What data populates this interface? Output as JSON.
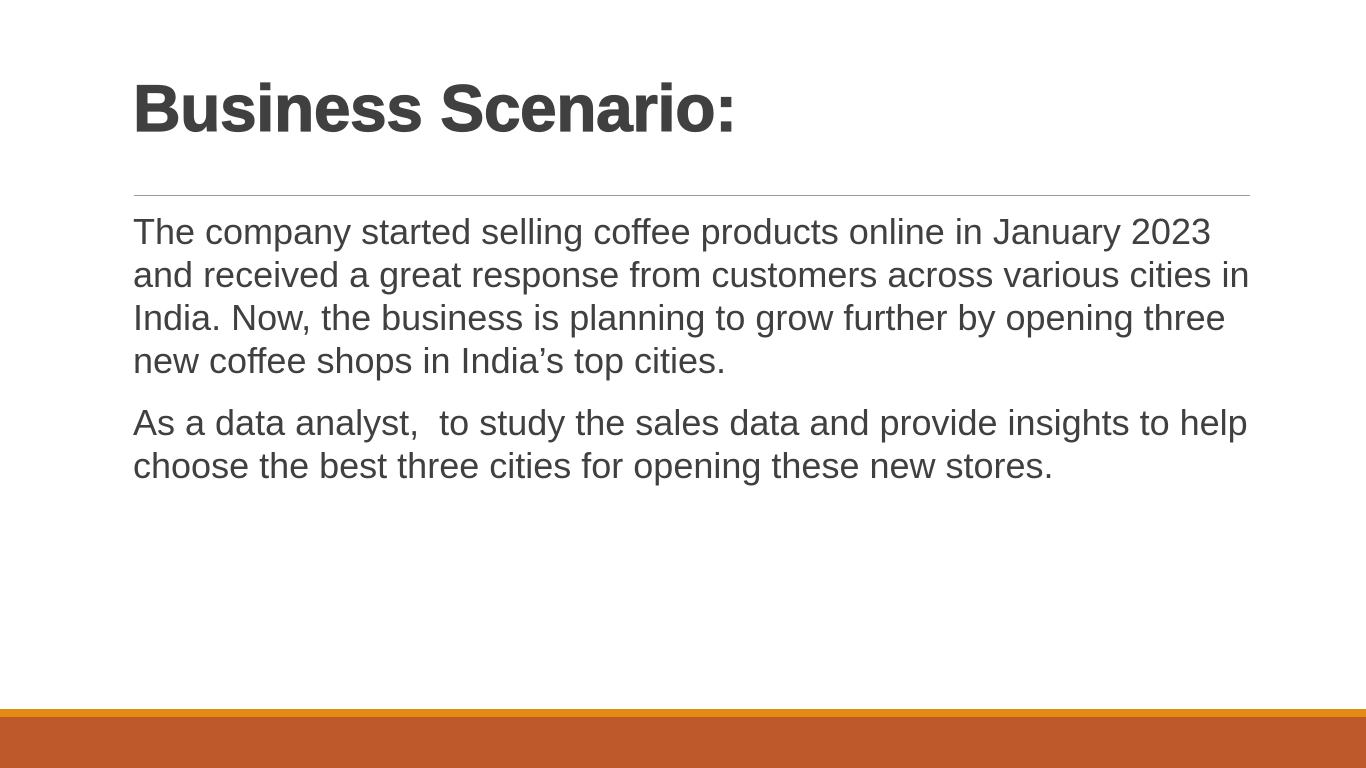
{
  "slide": {
    "title": "Business Scenario:",
    "paragraphs": [
      "The company started selling coffee products online in January 2023 and received a great response from customers across various cities in India. Now, the business is planning to grow further by opening three new coffee shops in India’s top cities.",
      "As a data analyst,  to study the sales data and provide insights to help choose the best three cities for opening these new stores."
    ]
  },
  "theme": {
    "text_color": "#404040",
    "accent_stripe": "#e38a12",
    "accent_bar": "#be592c"
  }
}
